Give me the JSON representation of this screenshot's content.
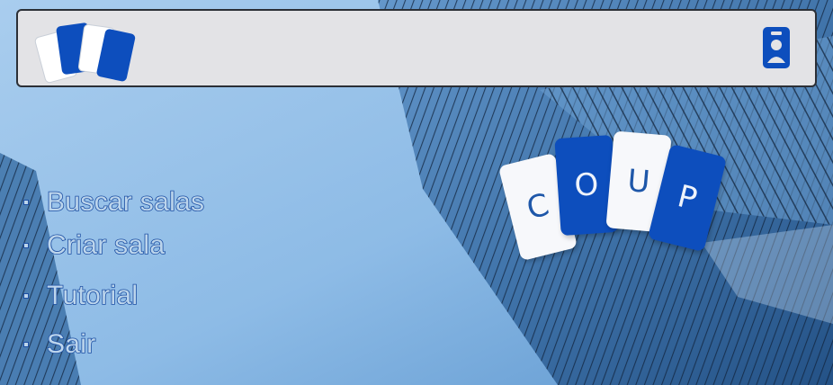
{
  "header": {
    "logo_icon": "cards-logo-icon",
    "profile_icon": "profile-badge-icon"
  },
  "menu": {
    "items": [
      {
        "label": "Buscar salas"
      },
      {
        "label": "Criar sala"
      },
      {
        "label": "Tutorial"
      },
      {
        "label": "Sair"
      }
    ]
  },
  "coup_logo": {
    "letters": [
      "C",
      "O",
      "U",
      "P"
    ]
  },
  "colors": {
    "accent_blue": "#0d4ebd",
    "header_bg": "#e3e3e6",
    "menu_text": "#bcd5ec"
  }
}
